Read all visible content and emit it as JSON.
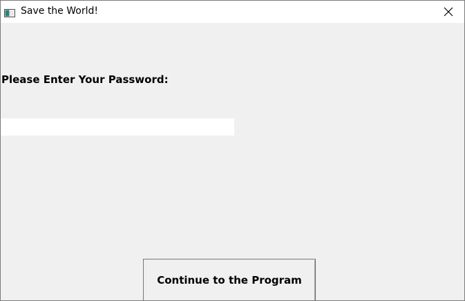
{
  "window": {
    "title": "Save the World!",
    "icon": "app-window-icon",
    "close_icon": "close-icon"
  },
  "form": {
    "prompt_label": "Please Enter Your Password:",
    "password_value": "",
    "password_placeholder": "",
    "continue_label": "Continue to the Program"
  },
  "colors": {
    "background": "#f0f0f0",
    "titlebar": "#ffffff",
    "input_background": "#ffffff"
  }
}
